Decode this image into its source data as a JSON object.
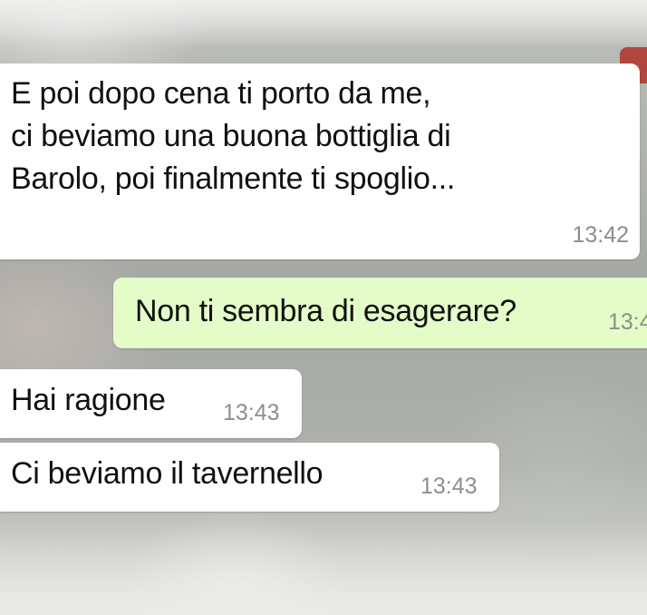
{
  "chat": {
    "messages": [
      {
        "direction": "incoming",
        "lines": [
          "E poi dopo cena ti porto da me,",
          "ci beviamo una buona bottiglia di",
          "Barolo, poi finalmente ti spoglio..."
        ],
        "time": "13:42"
      },
      {
        "direction": "outgoing",
        "text": "Non ti sembra di esagerare?",
        "time": "13:4"
      },
      {
        "direction": "incoming",
        "text": "Hai ragione",
        "time": "13:43"
      },
      {
        "direction": "incoming",
        "text": "Ci beviamo il tavernello",
        "time": "13:43"
      }
    ]
  },
  "colors": {
    "incoming_bubble": "#ffffff",
    "outgoing_bubble": "#e3fcc8",
    "timestamp": "#8d8f8c",
    "background": "#a9aba6"
  }
}
